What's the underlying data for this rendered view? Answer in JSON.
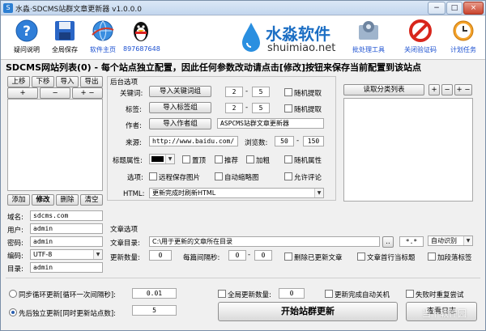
{
  "window": {
    "title": "水淼·SDCMS站群文章更新器 v1.0.0.0",
    "min_glyph": "−",
    "max_glyph": "□",
    "close_glyph": "×"
  },
  "toolbar": {
    "items": [
      {
        "label": "疑问说明",
        "icon": "question-icon"
      },
      {
        "label": "全局保存",
        "icon": "floppy-save-icon"
      },
      {
        "label": "软件主页",
        "icon": "globe-icon"
      },
      {
        "label": "897687648",
        "icon": "qq-penguin-icon"
      }
    ],
    "right_items": [
      {
        "label": "批处理工具",
        "icon": "gear-batch-icon"
      },
      {
        "label": "关闭验证码",
        "icon": "no-entry-icon"
      },
      {
        "label": "计划任务",
        "icon": "clock-icon"
      }
    ]
  },
  "logo": {
    "cn": "水淼软件",
    "en": "shuimiao.net"
  },
  "headline": "SDCMS网站列表(0) - 每个站点独立配置，因此任何参数改动请点击[修改]按钮来保存当前配置到该站点",
  "site_list": {
    "buttons_top": [
      "上移",
      "下移",
      "导入",
      "导出"
    ],
    "buttons_mid": [
      "+",
      "−",
      "+ −"
    ],
    "buttons_bottom": [
      "添加",
      "修改",
      "删除",
      "清空"
    ]
  },
  "site_form": {
    "domain_label": "域名:",
    "domain_value": "sdcms.com",
    "user_label": "用户:",
    "user_value": "admin",
    "pass_label": "密码:",
    "pass_value": "admin",
    "enc_label": "编码:",
    "enc_value": "UTF-8",
    "dir_label": "目录:",
    "dir_value": "admin"
  },
  "backend": {
    "title": "后台选项",
    "keyword_label": "关键词:",
    "keyword_btn": "导入关键词组",
    "keyword_from": "2",
    "keyword_to": "5",
    "keyword_random": "随机提取",
    "tag_label": "标签:",
    "tag_btn": "导入标签组",
    "tag_from": "2",
    "tag_to": "5",
    "tag_random": "随机提取",
    "author_label": "作者:",
    "author_btn": "导入作者组",
    "author_value": "ASPCMS站群文章更新器",
    "source_label": "来源:",
    "source_value": "http://www.baidu.com/",
    "views_label": "浏览数:",
    "views_from": "50",
    "views_to": "150",
    "attr_label": "标题属性:",
    "attr_top": "置顶",
    "attr_rec": "推荐",
    "attr_bold": "加粗",
    "attr_random": "随机属性",
    "opt_label": "选项:",
    "opt_remote": "远程保存图片",
    "opt_thumb": "自动缩略图",
    "opt_comment": "允许评论",
    "html_label": "HTML:",
    "html_value": "更新完成时刷新HTML",
    "dash": "-"
  },
  "category": {
    "read_btn": "读取分类列表",
    "btns": [
      "+",
      "−",
      "+ −"
    ]
  },
  "article": {
    "title": "文章选项",
    "dir_label": "文章目录:",
    "dir_value": "C:\\用于更新的文章所在目录",
    "browse": "..",
    "pattern": "*.*",
    "detect": "自动识别",
    "count_label": "更新数量:",
    "count_value": "0",
    "interval_label": "每篇间隔秒:",
    "int_from": "0",
    "int_to": "0",
    "del_after": "删除已更新文章",
    "first_line": "文章首行当标题",
    "paragraph_tag": "加段落标签"
  },
  "footer": {
    "sync_label": "同步循环更新[循环一次间隔秒]:",
    "sync_value": "0.01",
    "indep_label": "先后独立更新[同时更新站点数]:",
    "indep_value": "5",
    "global_label": "全局更新数量:",
    "global_value": "0",
    "shutdown": "更新完成自动关机",
    "retry": "失败时重复尝试",
    "start_btn": "开始站群更新",
    "log_btn": "查看日志",
    "watermark": "当下软件园"
  },
  "colors": {
    "accent": "#1d6fc4",
    "title_bar": "#c3d6ee"
  }
}
